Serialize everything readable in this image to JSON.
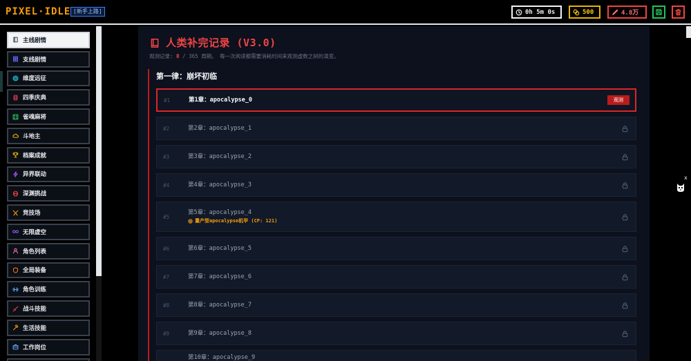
{
  "header": {
    "logo": "PIXEL·IDLE",
    "rank_badge": "[新手上路]",
    "timer": {
      "icon": "clock-icon",
      "value": "0h 5m 0s"
    },
    "coins": {
      "icon": "coin-icon",
      "value": "500"
    },
    "power": {
      "icon": "quill-icon",
      "value": "4.8万"
    },
    "actions": [
      {
        "icon": "save-icon"
      },
      {
        "icon": "trash-icon"
      }
    ]
  },
  "sidebar": {
    "items": [
      {
        "label": "主线剧情",
        "icon": "book-icon",
        "color": "#374151",
        "selected": true
      },
      {
        "label": "支线剧情",
        "icon": "scroll-icon",
        "color": "#6366f1"
      },
      {
        "label": "维度远征",
        "icon": "target-icon",
        "color": "#22d3ee"
      },
      {
        "label": "四季庆典",
        "icon": "lantern-icon",
        "color": "#f43f5e"
      },
      {
        "label": "雀魂麻将",
        "icon": "dice-icon",
        "color": "#22c55e"
      },
      {
        "label": "斗地主",
        "icon": "cloud-icon",
        "color": "#eab308"
      },
      {
        "label": "档案成就",
        "icon": "trophy-icon",
        "color": "#eab308"
      },
      {
        "label": "异界联动",
        "icon": "bolt-icon",
        "color": "#a855f7"
      },
      {
        "label": "深渊挑战",
        "icon": "skull-icon",
        "color": "#ef4444"
      },
      {
        "label": "竞技场",
        "icon": "swords-icon",
        "color": "#f59e0b"
      },
      {
        "label": "无限虚空",
        "icon": "infinity-icon",
        "color": "#8b5cf6"
      },
      {
        "label": "角色列表",
        "icon": "user-icon",
        "color": "#f472b6"
      },
      {
        "label": "全局装备",
        "icon": "shield-icon",
        "color": "#f97316"
      },
      {
        "label": "角色训练",
        "icon": "dumbbell-icon",
        "color": "#60a5fa"
      },
      {
        "label": "战斗技能",
        "icon": "sword-icon",
        "color": "#ef4444"
      },
      {
        "label": "生活技能",
        "icon": "hammer-icon",
        "color": "#f59e0b"
      },
      {
        "label": "工作岗位",
        "icon": "briefcase-icon",
        "color": "#60a5fa"
      }
    ]
  },
  "main": {
    "icon": "book-icon",
    "title": "人类补完记录 (V3.0)",
    "progress": {
      "label": "观测记录:",
      "current": "0",
      "total": "/ 365 周期。"
    },
    "description": "每一次阅读都需要消耗时间来观测虚数之树的演变。",
    "section_title": "第一律：崩坏初临",
    "chapters": [
      {
        "number": "#1",
        "title": "第1章：apocalypse_0",
        "action": "观测",
        "current": true
      },
      {
        "number": "#2",
        "title": "第2章：apocalypse_1",
        "locked": true
      },
      {
        "number": "#3",
        "title": "第3章：apocalypse_2",
        "locked": true
      },
      {
        "number": "#4",
        "title": "第4章：apocalypse_3",
        "locked": true
      },
      {
        "number": "#5",
        "title": "第5章：apocalypse_4",
        "locked": true,
        "enemy": {
          "icon": "target-icon",
          "text": "量产型apocalypse机甲 (CP: 121)"
        }
      },
      {
        "number": "#6",
        "title": "第6章：apocalypse_5",
        "locked": true
      },
      {
        "number": "#7",
        "title": "第7章：apocalypse_6",
        "locked": true
      },
      {
        "number": "#8",
        "title": "第8章：apocalypse_7",
        "locked": true
      },
      {
        "number": "#9",
        "title": "第9章：apocalypse_8",
        "locked": true
      },
      {
        "title": "第10章：apocalypse_9"
      }
    ]
  },
  "pet_widget": {
    "close_label": "x",
    "icon": "cat-icon"
  },
  "theme": {
    "accent_red": "#ef4444",
    "logo_orange": "#f59e0b",
    "coin_gold": "#eab308",
    "save_green": "#22c55e",
    "badge_blue": "#3b82f6",
    "panel_bg": "#0c111d",
    "row_bg": "#121929"
  }
}
